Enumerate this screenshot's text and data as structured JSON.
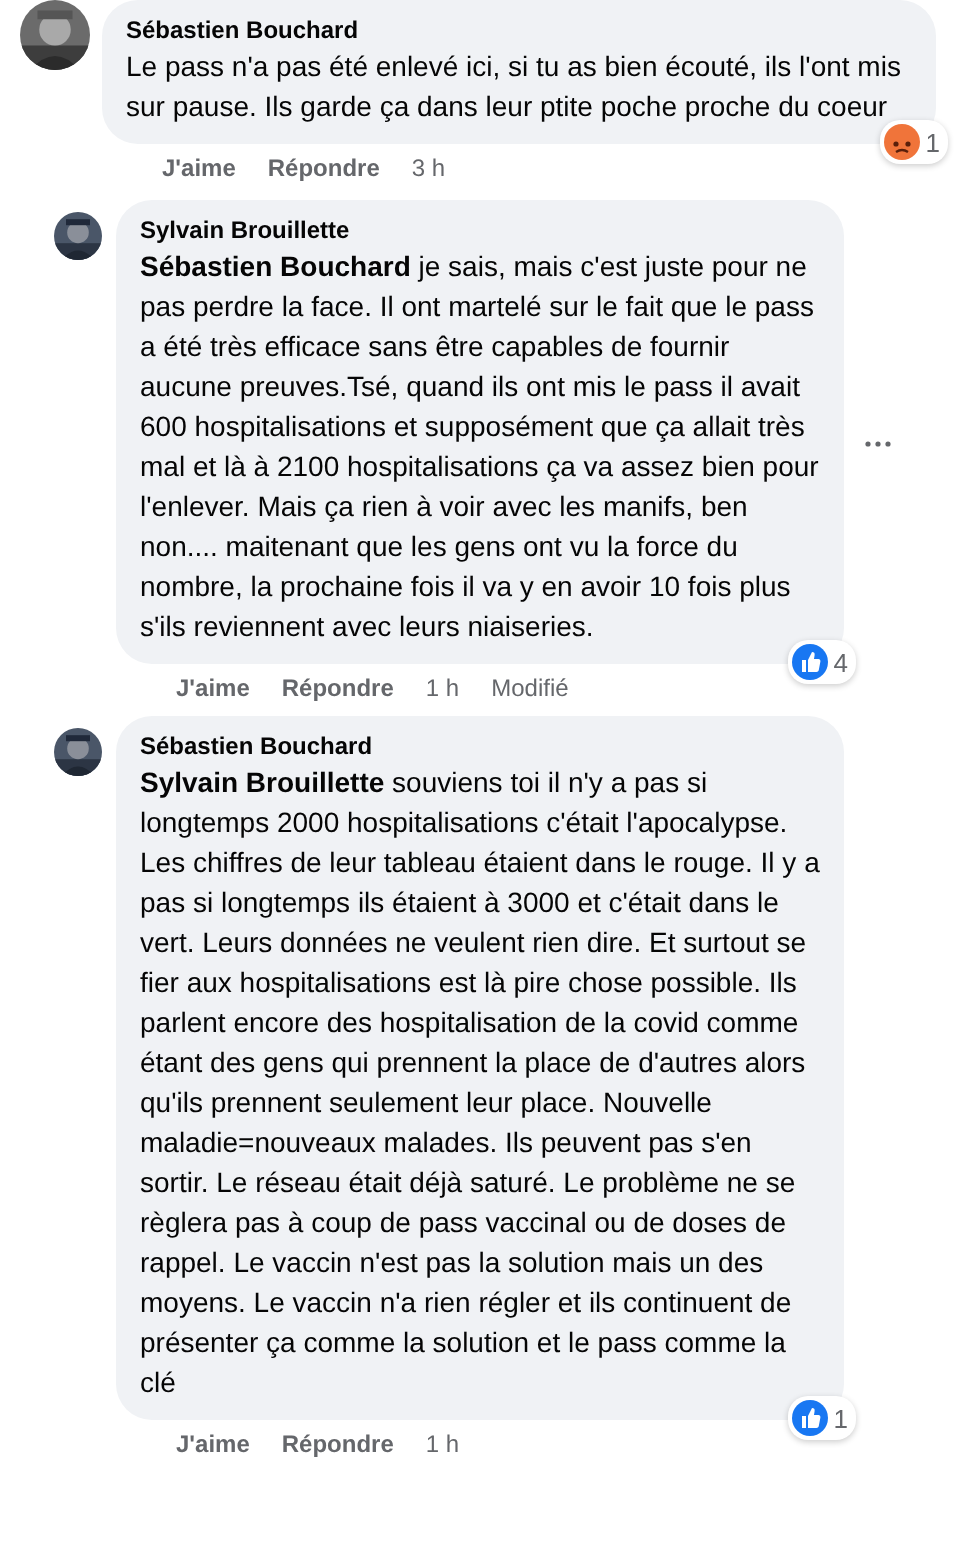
{
  "comments": [
    {
      "author": "Sébastien Bouchard",
      "text": "Le pass n'a pas été enlevé ici, si tu as bien écouté, ils l'ont mis sur pause. Ils garde ça dans leur ptite poche proche du coeur",
      "actions": [
        "J'aime",
        "Répondre"
      ],
      "time": "3 h",
      "reaction": {
        "kind": "angry",
        "count": "1"
      },
      "children": [
        {
          "author": "Sylvain Brouillette",
          "text": "**Sébastien Bouchard** je sais, mais c'est juste pour ne pas perdre la face. Il ont martelé sur le fait que le pass a été très efficace sans être capables de fournir aucune preuves.Tsé, quand ils ont mis le pass il avait 600 hospitalisations et supposément que ça allait très mal et là à 2100 hospitalisations ça va assez bien pour l'enlever. Mais ça rien à voir avec les manifs, ben non.... maitenant que les gens ont vu la force du nombre, la prochaine fois il va y en avoir 10 fois plus s'ils reviennent avec leurs niaiseries.",
          "actions": [
            "J'aime",
            "Répondre"
          ],
          "time": "1 h",
          "edited": "Modifié",
          "menu": true,
          "reaction": {
            "kind": "like",
            "count": "4"
          }
        },
        {
          "author": "Sébastien Bouchard",
          "text": "**Sylvain Brouillette** souviens toi il n'y a pas si longtemps 2000 hospitalisations c'était l'apocalypse. Les chiffres de leur tableau étaient dans le rouge. Il y a pas si longtemps ils étaient à 3000 et c'était dans le vert. Leurs données ne veulent rien dire. Et surtout se fier aux hospitalisations est là pire chose possible. Ils parlent encore des hospitalisation de la covid comme étant des gens qui prennent la place de d'autres alors qu'ils prennent seulement leur place. Nouvelle maladie=nouveaux malades. Ils peuvent pas s'en sortir. Le réseau était déjà saturé. Le problème ne se règlera pas à coup de pass vaccinal ou de doses de rappel. Le vaccin n'est pas la solution mais un des moyens. Le vaccin n'a rien régler et ils continuent de présenter ça comme la solution et le pass comme la clé",
          "actions": [
            "J'aime",
            "Répondre"
          ],
          "time": "1 h",
          "reaction": {
            "kind": "like",
            "count": "1"
          }
        }
      ]
    }
  ]
}
